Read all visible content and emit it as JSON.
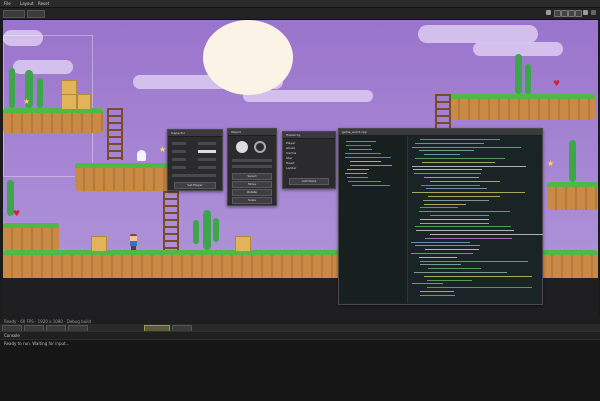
{
  "app": {
    "menu": [
      "File",
      "Layout",
      "Reset"
    ],
    "toolbar": {
      "field_1": "",
      "field_2": ""
    }
  },
  "colors": {
    "sky": "#9a74cc",
    "grass": "#4fb847",
    "dirt": "#c98a45",
    "panel_bg": "#2b2b2d",
    "code_bg": "#1e2a2e",
    "selected_tab": "#5b5b38"
  },
  "viewport": {
    "icons": [
      "play-icon",
      "grid-icon",
      "zoom-icon",
      "snap-icon",
      "camera-icon",
      "settings-icon"
    ]
  },
  "panels": {
    "inspector": {
      "title": "Inspector",
      "button": "Set Player"
    },
    "editor_tools": {
      "title": "Object",
      "buttons": [
        "Select",
        "Move",
        "Rotate",
        "Scale"
      ]
    },
    "hierarchy": {
      "title": "Hierarchy",
      "items": [
        "Player",
        "Ghost",
        "Cactus",
        "Star",
        "Heart",
        "Ladder"
      ],
      "button": "Add Node"
    },
    "code_editor": {
      "title": "game_world.cpp"
    }
  },
  "footer": {
    "status": "Ready · 60 FPS · 1920 x 1080 · Debug build",
    "tabs": [
      "Console",
      "Output",
      "Errors",
      "Profiler",
      "Assets",
      "Log"
    ],
    "active_tab": "Assets",
    "console_title": "Console",
    "console_message": "Ready to run. Waiting for input..."
  }
}
